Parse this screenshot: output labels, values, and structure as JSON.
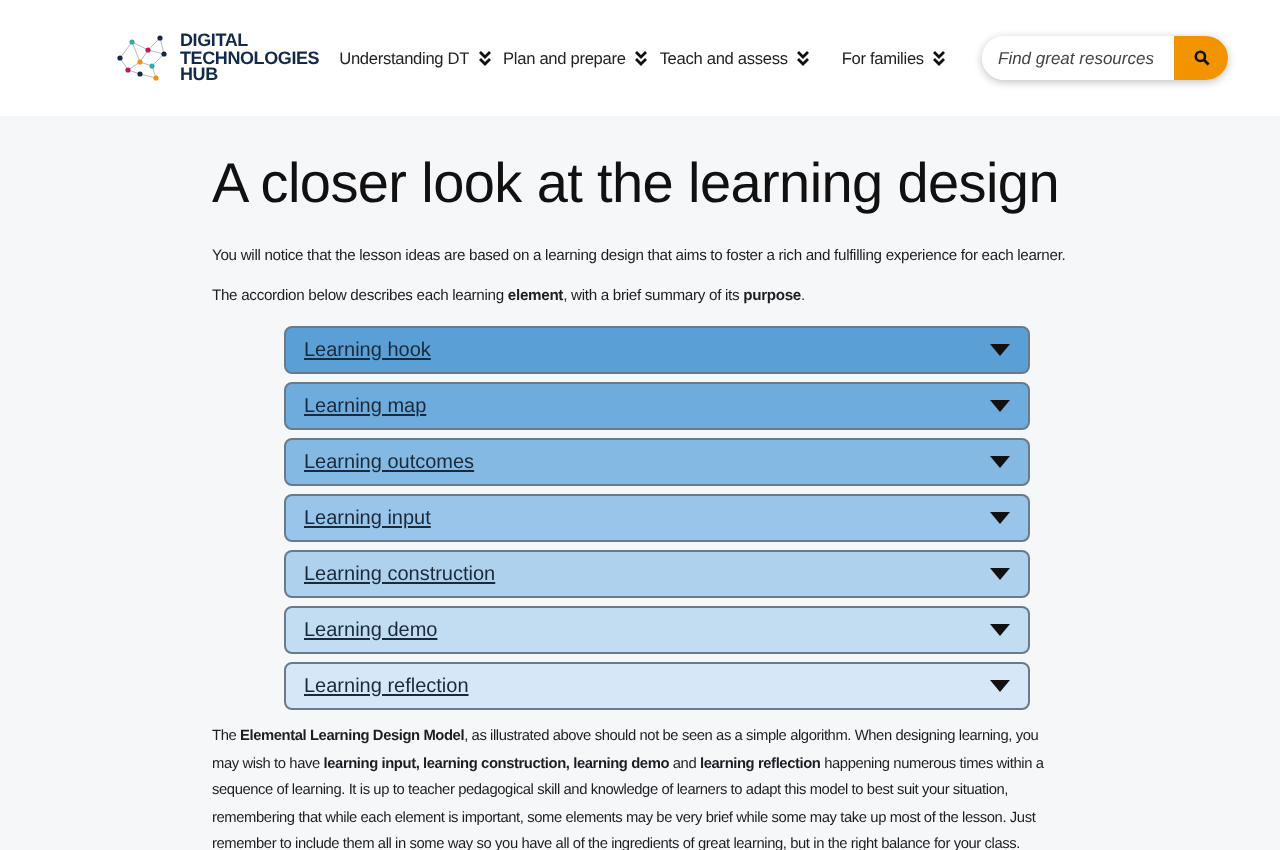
{
  "header": {
    "logo_lines": [
      "DIGITAL",
      "TECHNOLOGIES",
      "HUB"
    ],
    "nav": [
      {
        "label": "Understanding DT"
      },
      {
        "label": "Plan and prepare"
      },
      {
        "label": "Teach and assess"
      },
      {
        "label": "For families"
      }
    ],
    "search": {
      "placeholder": "Find great resources"
    }
  },
  "title": "A closer look at the learning design",
  "intro": [
    "You will notice that the lesson ideas are based on a learning design that aims to foster a rich and fulfilling experience for each learner.",
    "The accordion below describes each learning **element**, with a brief summary of its **purpose**."
  ],
  "accordion": [
    {
      "label": "Learning hook",
      "color": "#5a9fd6",
      "expanded": false
    },
    {
      "label": "Learning map",
      "color": "#6eacde",
      "expanded": false
    },
    {
      "label": "Learning outcomes",
      "color": "#84b9e3",
      "expanded": false
    },
    {
      "label": "Learning input",
      "color": "#98c5e9",
      "expanded": false
    },
    {
      "label": "Learning construction",
      "color": "#aed1ee",
      "expanded": false
    },
    {
      "label": "Learning demo",
      "color": "#c2ddf2",
      "expanded": false
    },
    {
      "label": "Learning reflection",
      "color": "#d6e8f7",
      "expanded": false
    }
  ],
  "body": "The **Elemental Learning Design Model**, as illustrated above should not be seen as a simple algorithm. When designing learning, you may wish to have **learning input, learning construction, learning demo** and **learning reflection** happening numerous times within a sequence of learning. It is up to teacher pedagogical skill and knowledge of learners to adapt this model to best suit your situation, remembering that while each element is important, some elements may be very brief while some may take up most of the lesson. Just remember to include them all in some way so you have all of the ingredients of great learning, but in the right balance for your class."
}
